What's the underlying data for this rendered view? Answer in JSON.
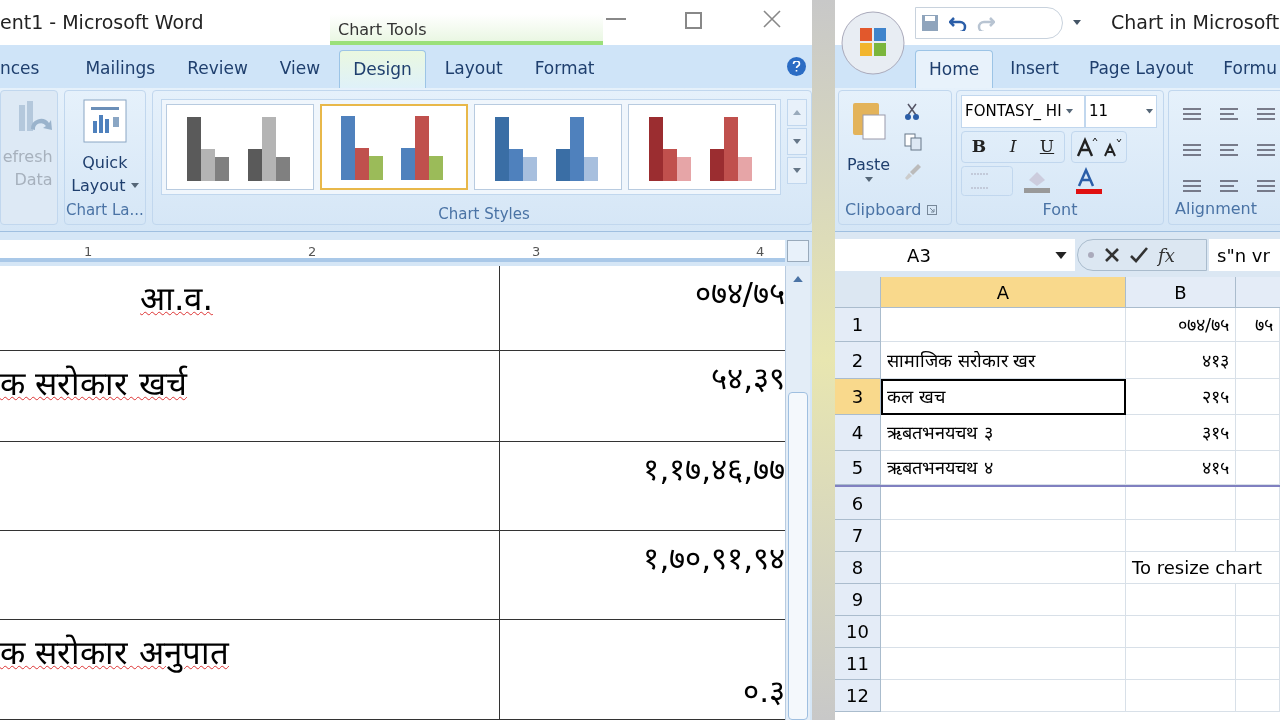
{
  "word": {
    "title": "ent1 - Microsoft Word",
    "context_group": "Chart Tools",
    "tabs": [
      {
        "label": "nces",
        "selected": false
      },
      {
        "label": "Mailings",
        "selected": false
      },
      {
        "label": "Review",
        "selected": false
      },
      {
        "label": "View",
        "selected": false
      },
      {
        "label": "Design",
        "selected": true
      },
      {
        "label": "Layout",
        "selected": false
      },
      {
        "label": "Format",
        "selected": false
      }
    ],
    "refresh": {
      "lines": [
        "efresh",
        "Data"
      ],
      "disabled": true
    },
    "quick_layout": {
      "lines": [
        "Quick",
        "Layout"
      ]
    },
    "chart_layouts_group": "Chart La...",
    "chart_styles": [
      {
        "selected": false,
        "bars": [
          {
            "color": "#5a5a5a"
          },
          {
            "color": "#b4b4b4"
          },
          {
            "color": "#808080"
          }
        ]
      },
      {
        "selected": true,
        "bars": [
          {
            "color": "#4f81bd"
          },
          {
            "color": "#c0504d"
          },
          {
            "color": "#9bbb59"
          }
        ]
      },
      {
        "selected": false,
        "bars": [
          {
            "color": "#3a6ea5"
          },
          {
            "color": "#4f81bd"
          },
          {
            "color": "#a7bfde"
          }
        ]
      },
      {
        "selected": false,
        "bars": [
          {
            "color": "#9b2d30"
          },
          {
            "color": "#c0504d"
          },
          {
            "color": "#e6a5a7"
          }
        ]
      }
    ],
    "chart_styles_group": "Chart Styles",
    "ruler": [
      "1",
      "2",
      "3",
      "4"
    ],
    "table": [
      {
        "label": "आ.व.",
        "value": "०७४/७५"
      },
      {
        "label": "क सरोकार खर्च",
        "value": "५४,३९"
      },
      {
        "value": "१,१७,४६,७७"
      },
      {
        "value": "१,७०,९१,९४"
      },
      {
        "label": "क सरोकार अनुपात",
        "value": "०.३"
      }
    ]
  },
  "excel": {
    "title": "Chart in Microsoft",
    "tabs": [
      {
        "label": "Home",
        "selected": true
      },
      {
        "label": "Insert",
        "selected": false
      },
      {
        "label": "Page Layout",
        "selected": false
      },
      {
        "label": "Formu",
        "selected": false
      }
    ],
    "paste": "Paste",
    "font_name": "FONTASY_ HI",
    "font_size": "11",
    "format_buttons": [
      "B",
      "I",
      "U"
    ],
    "groups": [
      "Clipboard",
      "Font",
      "Alignment"
    ],
    "name_box": "A3",
    "function_label": "fx",
    "formula": "s\"n vr",
    "columns": [
      {
        "label": "A",
        "selected": true
      },
      {
        "label": "B",
        "selected": false
      }
    ],
    "rows": [
      {
        "label": "1",
        "selected": false,
        "cells": [
          "",
          "०७४/७५",
          "७५"
        ]
      },
      {
        "label": "2",
        "selected": false,
        "cells": [
          "सामाजिक  सरोकार  खर",
          "४१३"
        ]
      },
      {
        "label": "3",
        "selected": true,
        "cells": [
          "कल  खच",
          "२१५"
        ]
      },
      {
        "label": "4",
        "selected": false,
        "cells": [
          "ऋबतभनयचथ  ३",
          "३१५"
        ]
      },
      {
        "label": "5",
        "selected": false,
        "cells": [
          "ऋबतभनयचथ  ४",
          "४१५"
        ]
      },
      {
        "label": "6",
        "selected": false,
        "cells": []
      },
      {
        "label": "7",
        "selected": false,
        "cells": []
      },
      {
        "label": "8",
        "selected": false,
        "overflow": true,
        "cells": [
          "",
          "To resize chart"
        ]
      },
      {
        "label": "9",
        "selected": false,
        "cells": []
      },
      {
        "label": "10",
        "selected": false,
        "cells": []
      },
      {
        "label": "11",
        "selected": false,
        "cells": []
      },
      {
        "label": "12",
        "selected": false,
        "cells": []
      }
    ]
  }
}
